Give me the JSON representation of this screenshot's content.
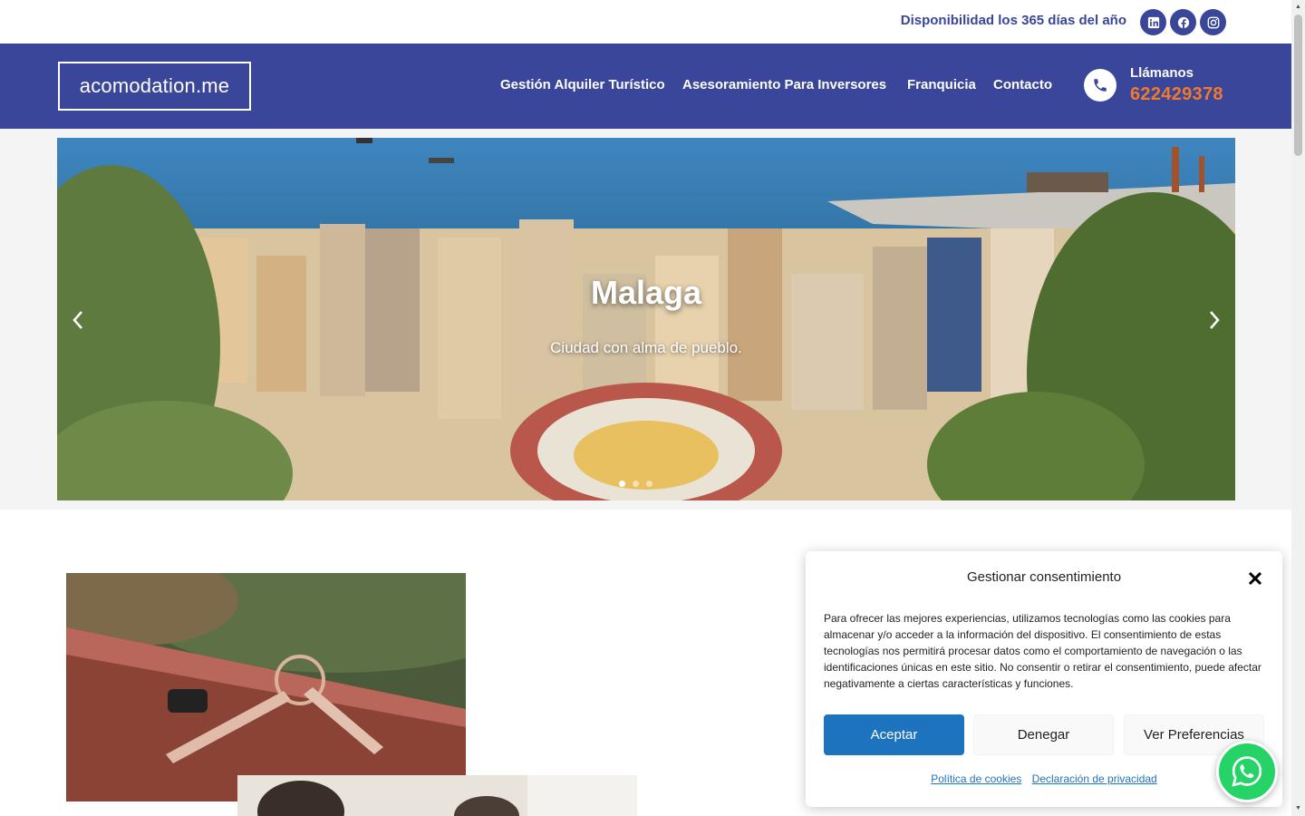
{
  "topbar": {
    "availability": "Disponibilidad los 365 días del año",
    "social": [
      {
        "name": "linkedin-icon"
      },
      {
        "name": "facebook-icon"
      },
      {
        "name": "instagram-icon"
      }
    ]
  },
  "header": {
    "logo": "acomodation.me",
    "nav": [
      {
        "label": "Gestión Alquiler Turístico"
      },
      {
        "label": "Asesoramiento Para Inversores"
      },
      {
        "label": "Franquicia"
      },
      {
        "label": "Contacto"
      }
    ],
    "call": {
      "label": "Llámanos",
      "number": "622429378"
    }
  },
  "hero": {
    "title": "Malaga",
    "subtitle": "Ciudad con alma de pueblo."
  },
  "cookie": {
    "title": "Gestionar consentimiento",
    "text": "Para ofrecer las mejores experiencias, utilizamos tecnologías como las cookies para almacenar y/o acceder a la información del dispositivo. El consentimiento de estas tecnologías nos permitirá procesar datos como el comportamiento de navegación o las identificaciones únicas en este sitio. No consentir o retirar el consentimiento, puede afectar negativamente a ciertas características y funciones.",
    "accept": "Aceptar",
    "deny": "Denegar",
    "preferences": "Ver Preferencias",
    "cookie_policy": "Política de cookies",
    "privacy": "Declaración de privacidad"
  },
  "colors": {
    "brand": "#3a4699",
    "accent": "#f07a2c",
    "button": "#1e73be",
    "whatsapp": "#25d366"
  }
}
